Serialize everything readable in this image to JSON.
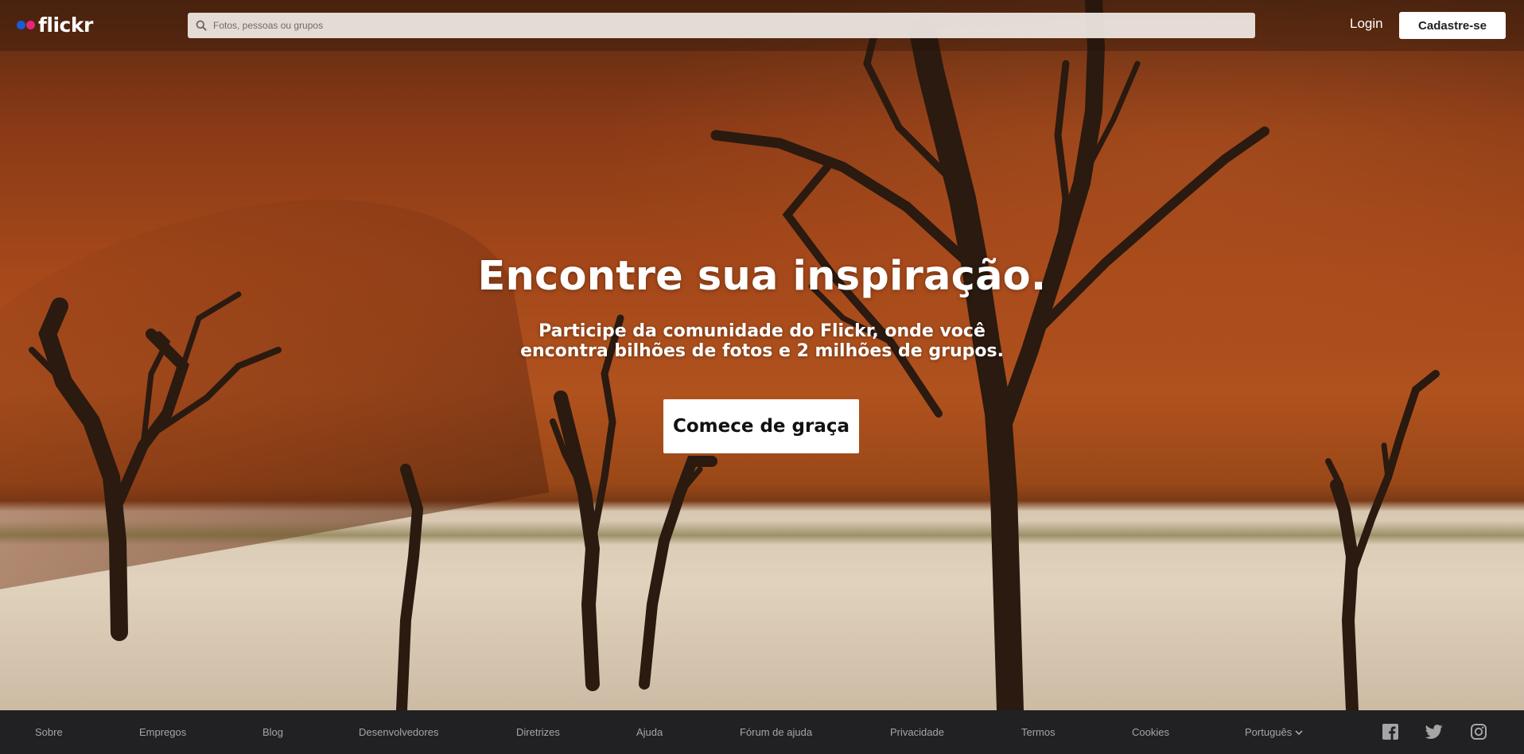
{
  "brand": {
    "name": "flickr",
    "colors": {
      "blue": "#1a5bd6",
      "pink": "#e8247a"
    }
  },
  "header": {
    "search": {
      "placeholder": "Fotos, pessoas ou grupos",
      "icon": "search-icon"
    },
    "login_label": "Login",
    "signup_label": "Cadastre-se"
  },
  "hero": {
    "headline": "Encontre sua inspiração.",
    "subtitle_line1": "Participe da comunidade do Flickr, onde você",
    "subtitle_line2": "encontra bilhões de fotos e 2 milhões de grupos.",
    "cta_label": "Comece de graça"
  },
  "footer": {
    "links": [
      "Sobre",
      "Empregos",
      "Blog",
      "Desenvolvedores",
      "Diretrizes",
      "Ajuda",
      "Fórum de ajuda",
      "Privacidade",
      "Termos",
      "Cookies"
    ],
    "language": "Português",
    "social_icons": [
      "facebook-icon",
      "twitter-icon",
      "instagram-icon"
    ]
  }
}
